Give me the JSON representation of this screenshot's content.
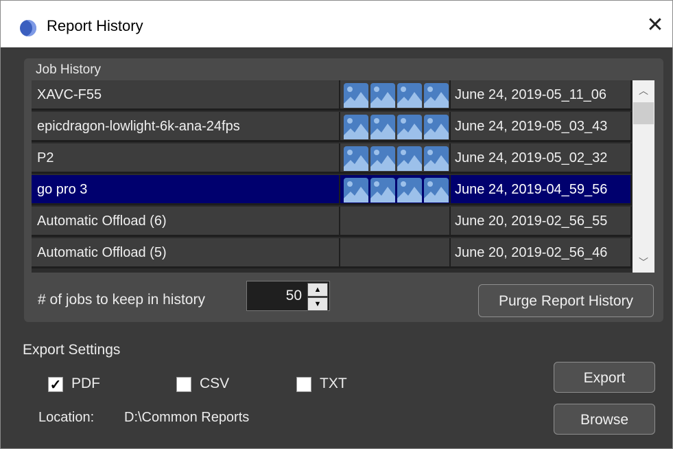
{
  "window": {
    "title": "Report History",
    "close_glyph": "✕"
  },
  "job_history": {
    "label": "Job History",
    "rows": [
      {
        "name": "XAVC-F55",
        "has_thumbs": true,
        "date": "June 24, 2019-05_11_06"
      },
      {
        "name": "epicdragon-lowlight-6k-ana-24fps",
        "has_thumbs": true,
        "date": "June 24, 2019-05_03_43"
      },
      {
        "name": "P2",
        "has_thumbs": true,
        "date": "June 24, 2019-05_02_32"
      },
      {
        "name": "go pro 3",
        "has_thumbs": true,
        "date": "June 24, 2019-04_59_56",
        "selected": true
      },
      {
        "name": "Automatic Offload (6)",
        "has_thumbs": false,
        "date": "June 20, 2019-02_56_55"
      },
      {
        "name": "Automatic Offload (5)",
        "has_thumbs": false,
        "date": "June 20, 2019-02_56_46"
      }
    ],
    "keep_label": "# of jobs to keep in history",
    "keep_value": "50",
    "purge_label": "Purge Report History"
  },
  "export": {
    "title": "Export Settings",
    "pdf_label": "PDF",
    "pdf_checked": true,
    "csv_label": "CSV",
    "csv_checked": false,
    "txt_label": "TXT",
    "txt_checked": false,
    "location_label": "Location:",
    "location_value": "D:\\Common Reports",
    "export_label": "Export",
    "browse_label": "Browse"
  },
  "icons": {
    "app": "app-circle-icon",
    "thumb": "image-thumbnail-icon",
    "scroll_up": "chevron-up-icon",
    "scroll_down": "chevron-down-icon",
    "check": "checkmark-icon"
  },
  "colors": {
    "background": "#3a3a3a",
    "panel": "#4a4a4a",
    "selection": "#00006e",
    "thumb": "#4a7ec2"
  }
}
